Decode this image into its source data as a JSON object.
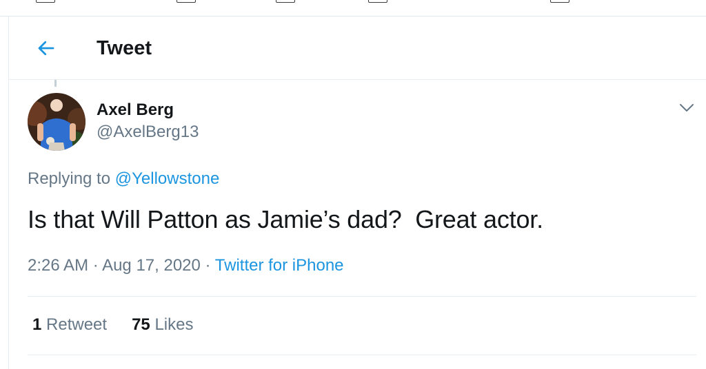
{
  "header": {
    "title": "Tweet",
    "back_icon": "arrow-left-icon"
  },
  "tweet": {
    "author": {
      "name": "Axel Berg",
      "handle": "@AxelBerg13"
    },
    "replying_prefix": "Replying to ",
    "replying_to": "@Yellowstone",
    "text": "Is that Will Patton as Jamie’s dad?  Great actor.",
    "time": "2:26 AM",
    "separator": " · ",
    "date": "Aug 17, 2020",
    "source": "Twitter for iPhone",
    "retweets": {
      "count": "1",
      "label": "Retweet"
    },
    "likes": {
      "count": "75",
      "label": "Likes"
    }
  },
  "colors": {
    "accent": "#1b95e0",
    "secondary_text": "#657786",
    "primary_text": "#14171a",
    "border": "#e6ecf0"
  }
}
